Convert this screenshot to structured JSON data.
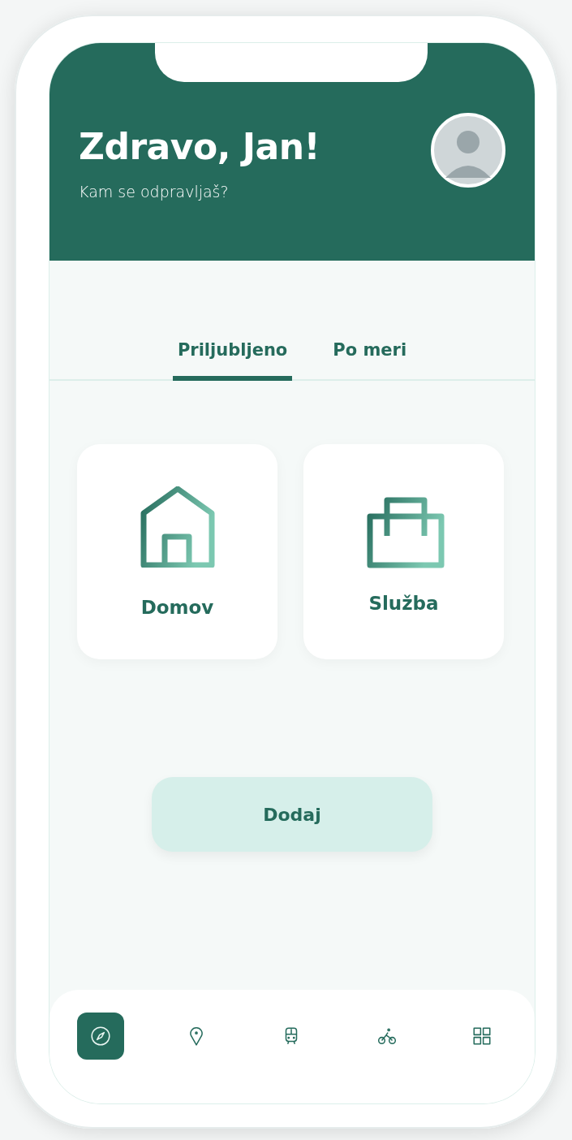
{
  "header": {
    "greeting": "Zdravo, Jan!",
    "subtitle": "Kam se odpravljaš?"
  },
  "tabs": [
    {
      "label": "Priljubljeno",
      "selected": true
    },
    {
      "label": "Po meri",
      "selected": false
    }
  ],
  "favorites": [
    {
      "kind": "home",
      "label": "Domov"
    },
    {
      "kind": "work",
      "label": "Služba"
    }
  ],
  "add_button": {
    "label": "Dodaj"
  },
  "bottom_nav": [
    {
      "kind": "explore",
      "selected": true
    },
    {
      "kind": "location",
      "selected": false
    },
    {
      "kind": "train",
      "selected": false
    },
    {
      "kind": "bike",
      "selected": false
    },
    {
      "kind": "menu",
      "selected": false
    }
  ]
}
